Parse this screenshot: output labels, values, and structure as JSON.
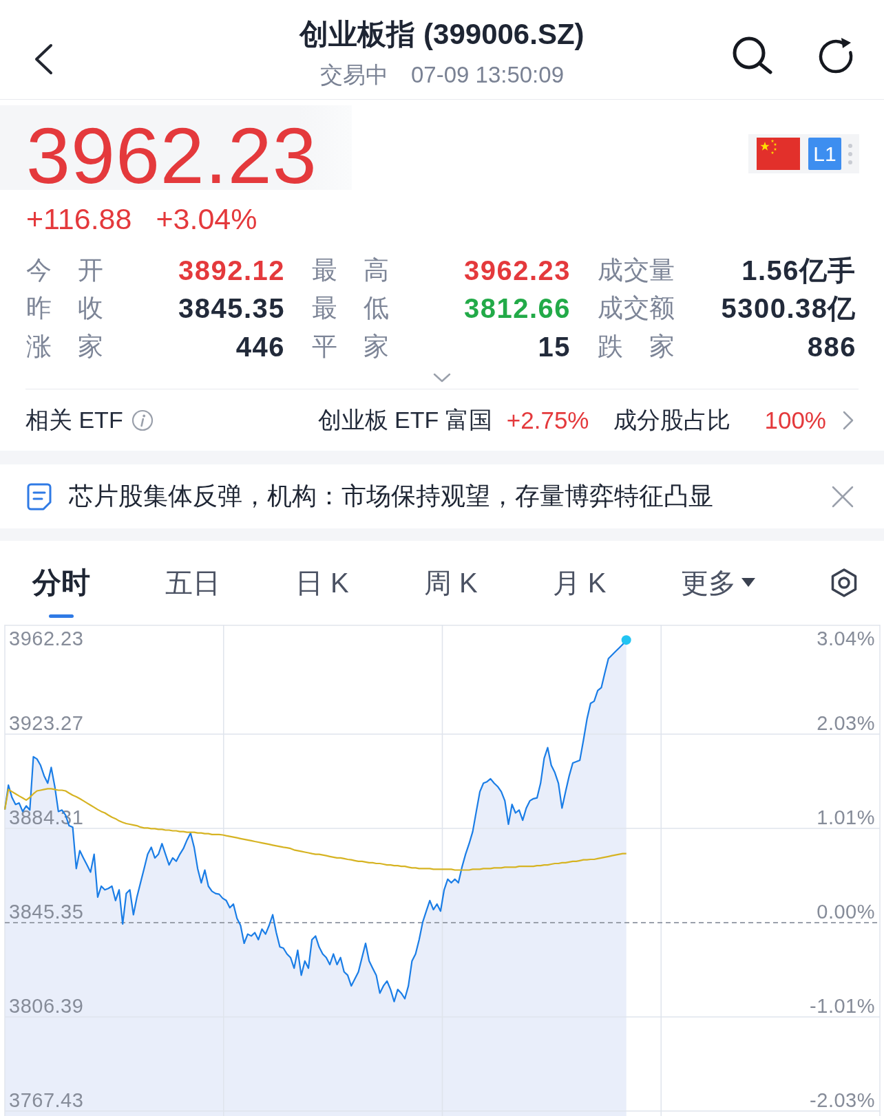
{
  "header": {
    "title": "创业板指 (399006.SZ)",
    "status": "交易中",
    "time": "07-09 13:50:09"
  },
  "quote": {
    "price": "3962.23",
    "change": "+116.88",
    "change_pct": "+3.04%",
    "market_badge": "L1"
  },
  "stats": {
    "expanded": false,
    "items": [
      {
        "label": "今 开",
        "value": "3892.12",
        "color": "#e4393c"
      },
      {
        "label": "最 高",
        "value": "3962.23",
        "color": "#e4393c"
      },
      {
        "label": "成交量",
        "value": "1.56亿手",
        "color": "#222a3a"
      },
      {
        "label": "昨 收",
        "value": "3845.35",
        "color": "#222a3a"
      },
      {
        "label": "最 低",
        "value": "3812.66",
        "color": "#22aa48"
      },
      {
        "label": "成交额",
        "value": "5300.38亿",
        "color": "#222a3a"
      },
      {
        "label": "涨 家",
        "value": "446",
        "color": "#222a3a"
      },
      {
        "label": "平 家",
        "value": "15",
        "color": "#222a3a"
      },
      {
        "label": "跌 家",
        "value": "886",
        "color": "#222a3a"
      }
    ]
  },
  "etf": {
    "label": "相关 ETF",
    "fund": "创业板 ETF 富国",
    "fund_change": "+2.75%",
    "share_label": "成分股占比",
    "share_value": "100%"
  },
  "news": {
    "headline": "芯片股集体反弹，机构：市场保持观望，存量博弈特征凸显"
  },
  "tabs": [
    {
      "label": "分时",
      "selected": true,
      "kind": "tab"
    },
    {
      "label": "五日",
      "selected": false,
      "kind": "tab"
    },
    {
      "label": "日 K",
      "selected": false,
      "kind": "tab"
    },
    {
      "label": "周 K",
      "selected": false,
      "kind": "tab"
    },
    {
      "label": "月 K",
      "selected": false,
      "kind": "tab"
    },
    {
      "label": "更多",
      "selected": false,
      "kind": "menu"
    }
  ],
  "chart": {
    "percent_labels": [
      "3.04%",
      "2.03%",
      "1.01%",
      "0.00%",
      "-1.01%",
      "-2.03%"
    ],
    "chart_data": {
      "type": "area",
      "grid": true,
      "ylim": [
        3765.4,
        3968.5
      ],
      "yticks": [
        {
          "value": 3962.23,
          "label": "3962.23"
        },
        {
          "value": 3923.27,
          "label": "3923.27"
        },
        {
          "value": 3884.31,
          "label": "3884.31"
        },
        {
          "value": 3845.35,
          "label": "3845.35"
        },
        {
          "value": 3806.39,
          "label": "3806.39"
        },
        {
          "value": 3767.43,
          "label": "3767.43"
        }
      ],
      "ref_lines": [
        {
          "axis": "y",
          "value": 3845.35
        }
      ],
      "series": [
        {
          "type": "area",
          "color": "#1a7de6",
          "values": [
            3892.1,
            3902.2,
            3897.1,
            3894.2,
            3894.8,
            3891.3,
            3893.6,
            3891.9,
            3913.9,
            3913.0,
            3910.4,
            3906.0,
            3903.0,
            3909.5,
            3901.6,
            3891.3,
            3891.9,
            3889.8,
            3885.4,
            3884.8,
            3867.7,
            3875.1,
            3872.1,
            3869.2,
            3866.2,
            3873.6,
            3855.9,
            3860.4,
            3858.9,
            3859.5,
            3860.4,
            3854.5,
            3858.9,
            3844.8,
            3857.4,
            3858.9,
            3848.6,
            3855.9,
            3861.8,
            3867.7,
            3873.6,
            3876.5,
            3872.1,
            3873.6,
            3878.0,
            3873.6,
            3869.2,
            3872.1,
            3870.7,
            3873.6,
            3876.0,
            3879.5,
            3882.4,
            3876.5,
            3867.7,
            3861.8,
            3867.1,
            3860.4,
            3858.3,
            3857.4,
            3857.1,
            3855.4,
            3854.5,
            3851.5,
            3853.0,
            3847.1,
            3844.2,
            3836.8,
            3840.6,
            3839.8,
            3841.2,
            3838.3,
            3842.7,
            3840.6,
            3844.2,
            3848.6,
            3841.2,
            3835.3,
            3834.8,
            3832.4,
            3830.9,
            3826.5,
            3833.9,
            3823.6,
            3829.5,
            3826.5,
            3838.3,
            3839.8,
            3835.3,
            3832.4,
            3830.9,
            3828.0,
            3832.4,
            3828.0,
            3830.9,
            3825.0,
            3823.6,
            3819.2,
            3822.1,
            3825.0,
            3830.9,
            3836.8,
            3829.5,
            3826.5,
            3823.6,
            3816.2,
            3819.2,
            3821.2,
            3817.7,
            3812.7,
            3817.7,
            3816.2,
            3813.9,
            3819.2,
            3829.5,
            3832.4,
            3838.3,
            3845.6,
            3850.1,
            3854.5,
            3850.7,
            3853.0,
            3850.1,
            3858.9,
            3863.3,
            3861.8,
            3863.3,
            3861.8,
            3868.3,
            3873.6,
            3878.0,
            3883.0,
            3891.3,
            3899.5,
            3903.0,
            3903.6,
            3904.8,
            3903.0,
            3901.6,
            3899.5,
            3895.7,
            3886.0,
            3894.2,
            3890.7,
            3891.9,
            3887.7,
            3892.7,
            3895.7,
            3896.6,
            3896.9,
            3903.0,
            3913.3,
            3917.7,
            3910.4,
            3907.4,
            3903.0,
            3892.7,
            3899.5,
            3906.0,
            3911.3,
            3911.9,
            3912.5,
            3920.7,
            3929.5,
            3936.0,
            3936.9,
            3941.3,
            3942.5,
            3948.6,
            3954.5,
            3956.0,
            3957.5,
            3958.9,
            3960.4,
            3962.2,
            null,
            null,
            null,
            null,
            null,
            null,
            null,
            null,
            null,
            null,
            null,
            null,
            null,
            null,
            null,
            null,
            null,
            null,
            null,
            null,
            null,
            null,
            null,
            null,
            null,
            null,
            null,
            null,
            null,
            null,
            null,
            null,
            null,
            null,
            null,
            null,
            null,
            null,
            null,
            null,
            null,
            null,
            null,
            null,
            null,
            null,
            null,
            null,
            null,
            null,
            null,
            null,
            null,
            null,
            null,
            null,
            null,
            null,
            null,
            null,
            null,
            null,
            null,
            null,
            null,
            null,
            null,
            null,
            null,
            null,
            null
          ]
        },
        {
          "type": "line",
          "color": "#d6b322",
          "values": [
            3892.1,
            3900.4,
            3899.5,
            3898.6,
            3897.7,
            3896.9,
            3896.0,
            3897.1,
            3898.6,
            3899.8,
            3900.1,
            3900.4,
            3900.7,
            3900.7,
            3900.4,
            3900.1,
            3900.1,
            3899.8,
            3898.9,
            3898.0,
            3897.4,
            3896.6,
            3895.7,
            3894.8,
            3893.9,
            3893.0,
            3892.1,
            3891.3,
            3890.7,
            3889.8,
            3888.9,
            3888.3,
            3887.4,
            3886.8,
            3886.3,
            3886.0,
            3885.7,
            3885.4,
            3884.8,
            3884.5,
            3884.5,
            3884.2,
            3884.2,
            3883.9,
            3883.9,
            3883.6,
            3883.6,
            3883.3,
            3883.3,
            3883.0,
            3883.0,
            3882.7,
            3882.7,
            3882.7,
            3882.4,
            3882.4,
            3882.1,
            3882.1,
            3881.8,
            3881.8,
            3881.8,
            3881.6,
            3881.3,
            3881.0,
            3880.7,
            3880.4,
            3880.1,
            3879.8,
            3879.5,
            3879.2,
            3878.9,
            3878.6,
            3878.3,
            3878.0,
            3877.7,
            3877.4,
            3877.1,
            3876.8,
            3876.5,
            3876.3,
            3876.0,
            3875.4,
            3875.1,
            3874.8,
            3874.5,
            3874.2,
            3873.9,
            3873.6,
            3873.6,
            3873.3,
            3873.0,
            3872.7,
            3872.4,
            3872.1,
            3872.1,
            3871.8,
            3871.5,
            3871.3,
            3871.0,
            3870.7,
            3870.7,
            3870.4,
            3870.1,
            3870.1,
            3869.8,
            3869.8,
            3869.5,
            3869.2,
            3869.2,
            3868.9,
            3868.9,
            3868.6,
            3868.6,
            3868.3,
            3868.0,
            3868.0,
            3867.7,
            3867.7,
            3867.7,
            3867.7,
            3867.4,
            3867.4,
            3867.4,
            3867.4,
            3867.4,
            3867.4,
            3867.1,
            3867.1,
            3867.1,
            3867.1,
            3867.1,
            3867.4,
            3867.4,
            3867.4,
            3867.7,
            3867.7,
            3867.7,
            3868.0,
            3868.0,
            3868.0,
            3868.3,
            3868.3,
            3868.3,
            3868.3,
            3868.6,
            3868.6,
            3868.6,
            3868.6,
            3868.6,
            3868.9,
            3868.9,
            3869.2,
            3869.2,
            3869.5,
            3869.8,
            3869.8,
            3870.1,
            3870.1,
            3870.4,
            3870.7,
            3870.7,
            3871.0,
            3871.3,
            3871.3,
            3871.5,
            3871.5,
            3871.8,
            3872.1,
            3872.4,
            3872.7,
            3873.0,
            3873.3,
            3873.6,
            3873.9,
            3873.9,
            null,
            null,
            null,
            null,
            null,
            null,
            null,
            null,
            null,
            null,
            null,
            null,
            null,
            null,
            null,
            null,
            null,
            null,
            null,
            null,
            null,
            null,
            null,
            null,
            null,
            null,
            null,
            null,
            null,
            null,
            null,
            null,
            null,
            null,
            null,
            null,
            null,
            null,
            null,
            null,
            null,
            null,
            null,
            null,
            null,
            null,
            null,
            null,
            null,
            null,
            null,
            null,
            null,
            null,
            null,
            null,
            null,
            null,
            null,
            null,
            null,
            null,
            null,
            null,
            null,
            null,
            null,
            null,
            null,
            null,
            null
          ]
        }
      ]
    }
  }
}
